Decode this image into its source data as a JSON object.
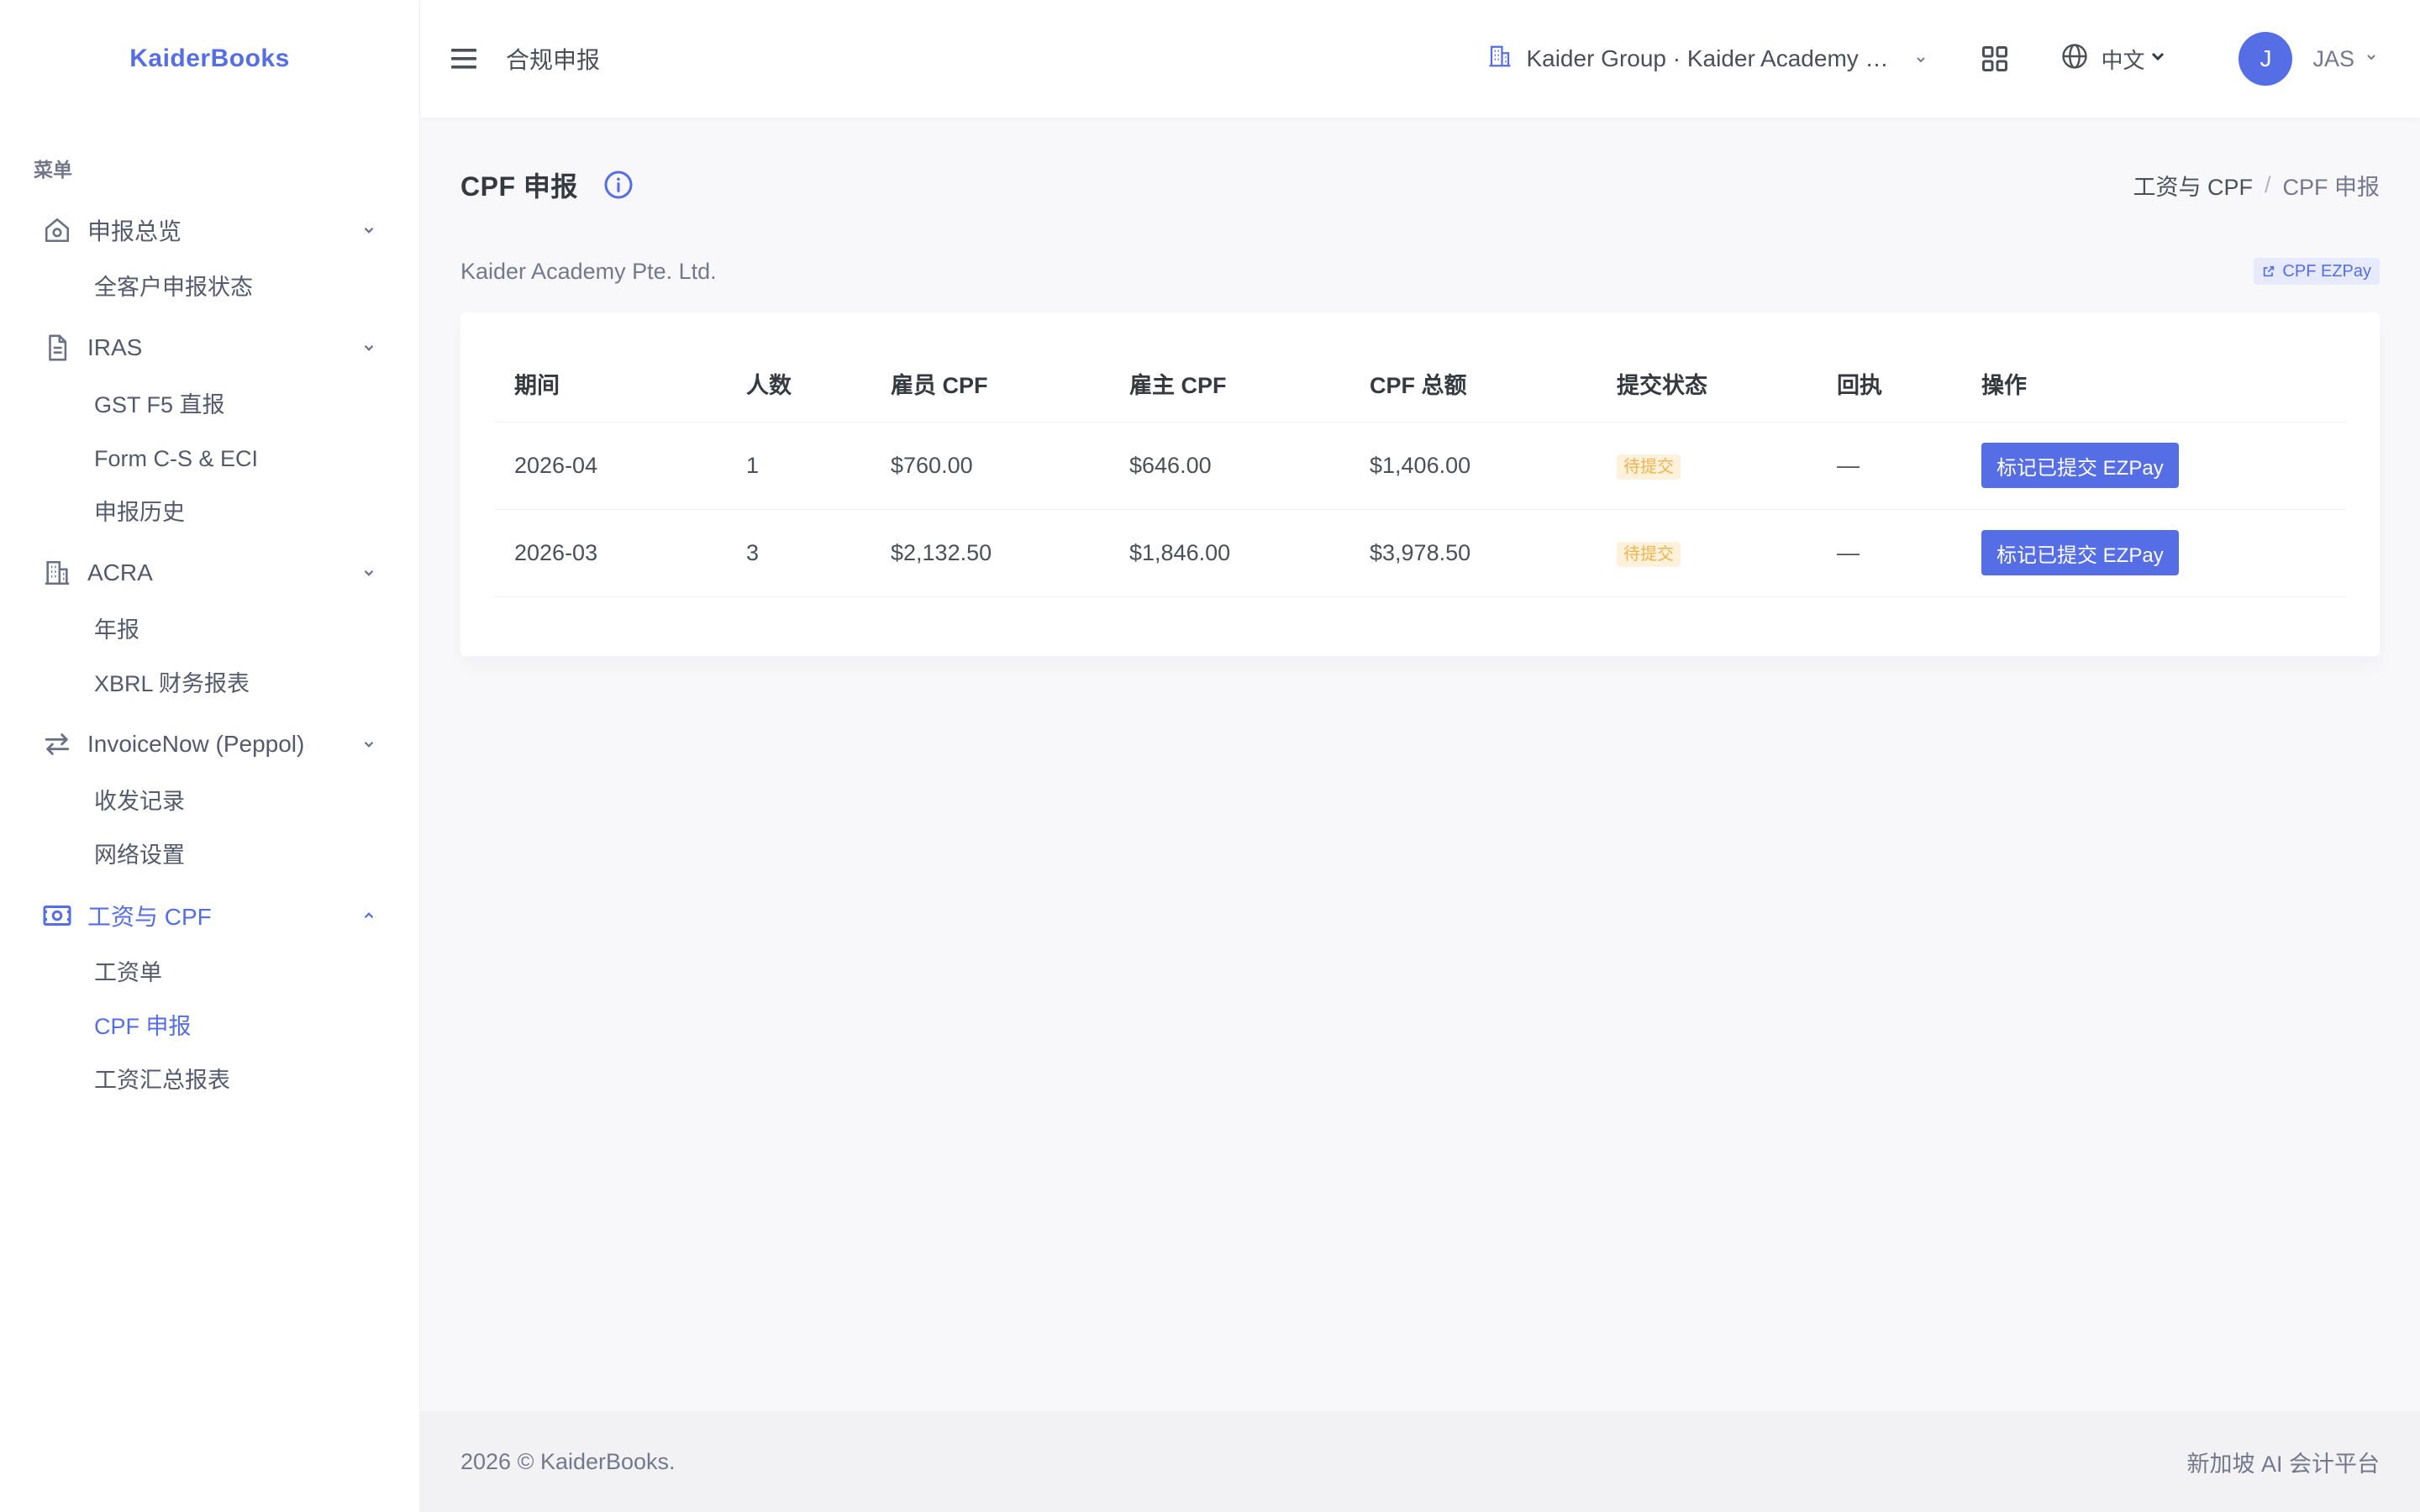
{
  "brand": "KaiderBooks",
  "colors": {
    "accent": "#556ee6",
    "warning": "#f1b44c",
    "text": "#495057",
    "muted": "#74788d"
  },
  "sidebar": {
    "menu_title": "菜单",
    "groups": [
      {
        "label": "申报总览",
        "icon": "home-icon",
        "expanded": true,
        "items": [
          "全客户申报状态"
        ]
      },
      {
        "label": "IRAS",
        "icon": "document-icon",
        "expanded": true,
        "items": [
          "GST F5 直报",
          "Form C-S & ECI",
          "申报历史"
        ]
      },
      {
        "label": "ACRA",
        "icon": "building-icon",
        "expanded": true,
        "items": [
          "年报",
          "XBRL 财务报表"
        ]
      },
      {
        "label": "InvoiceNow (Peppol)",
        "icon": "swap-icon",
        "expanded": true,
        "items": [
          "收发记录",
          "网络设置"
        ]
      },
      {
        "label": "工资与 CPF",
        "icon": "money-icon",
        "expanded": true,
        "active": true,
        "items": [
          "工资单",
          "CPF 申报",
          "工资汇总报表"
        ],
        "active_item": "CPF 申报"
      }
    ]
  },
  "topbar": {
    "title": "合规申报",
    "org": "Kaider Group · Kaider Academy Pte. Ltd.",
    "language": "中文",
    "avatar_initial": "J",
    "username": "JAS"
  },
  "page": {
    "title": "CPF 申报",
    "breadcrumb": [
      "工资与 CPF",
      "CPF 申报"
    ],
    "company": "Kaider Academy Pte. Ltd.",
    "ezpay_link": "CPF EZPay"
  },
  "table": {
    "headers": [
      "期间",
      "人数",
      "雇员 CPF",
      "雇主 CPF",
      "CPF 总额",
      "提交状态",
      "回执",
      "操作"
    ],
    "rows": [
      {
        "period": "2026-04",
        "count": "1",
        "employee": "$760.00",
        "employer": "$646.00",
        "total": "$1,406.00",
        "status": "待提交",
        "receipt": "—",
        "action": "标记已提交 EZPay"
      },
      {
        "period": "2026-03",
        "count": "3",
        "employee": "$2,132.50",
        "employer": "$1,846.00",
        "total": "$3,978.50",
        "status": "待提交",
        "receipt": "—",
        "action": "标记已提交 EZPay"
      }
    ]
  },
  "footer": {
    "left": "2026 © KaiderBooks.",
    "right": "新加坡 AI 会计平台"
  }
}
